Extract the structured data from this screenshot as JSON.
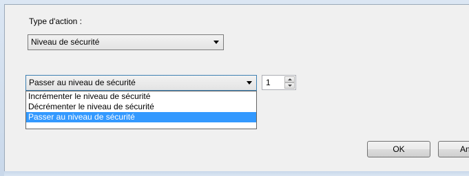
{
  "action_type": {
    "label": "Type d'action :",
    "selected": "Niveau de sécurité"
  },
  "security_action": {
    "selected": "Passer au niveau de sécurité",
    "options": [
      "Incrémenter le niveau de sécurité",
      "Décrémenter le niveau de sécurité",
      "Passer au niveau de sécurité"
    ],
    "highlighted_index": 2
  },
  "level_spinner": {
    "value": "1"
  },
  "buttons": {
    "ok_label": "OK",
    "cancel_label_visible": "An"
  },
  "colors": {
    "dialog_background": "#f0f0f0",
    "selection_highlight": "#3399ff",
    "frame": "#dbe6f3"
  }
}
